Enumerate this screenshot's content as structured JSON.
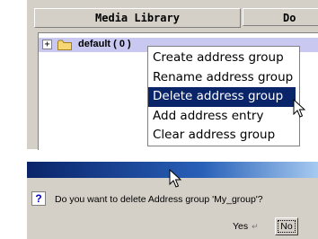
{
  "library": {
    "tabs": [
      {
        "label": "Media Library"
      },
      {
        "label": "Do"
      }
    ],
    "tree": {
      "expander_symbol": "+",
      "node_label": "default ( 0 )",
      "folder_icon": "folder-icon"
    }
  },
  "context_menu": {
    "items": [
      {
        "label": "Create address group"
      },
      {
        "label": "Rename address group"
      },
      {
        "label": "Delete address group"
      },
      {
        "label": "Add address entry"
      },
      {
        "label": "Clear address group"
      }
    ],
    "highlighted_label": "Delete address group"
  },
  "dialog": {
    "icon_glyph": "?",
    "message": "Do you want to delete Address group  'My_group'?",
    "yes_label": "Yes",
    "no_label": "No"
  },
  "colors": {
    "panel": "#d4d0c8",
    "selection": "#0a246a",
    "row_highlight": "#c8c8f0",
    "titlebar_start": "#0a246a",
    "titlebar_end": "#a6caf0"
  }
}
